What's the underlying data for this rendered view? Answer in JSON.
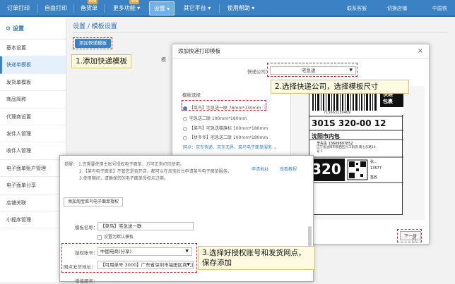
{
  "topnav": {
    "items": [
      "订单打印",
      "自由打印",
      "备货单",
      "更多功能",
      "设置",
      "其它平台",
      "使用帮助"
    ],
    "badge": "new",
    "right": [
      "联系客服",
      "切换店铺",
      "中国铁"
    ]
  },
  "sidebar": {
    "title": "设置",
    "items": [
      "基本设置",
      "快递单模板",
      "发货单模板",
      "商品简称",
      "代理商设置",
      "发件人管理",
      "收件人管理",
      "电子面单账户管理",
      "电子面单分享",
      "店铺关联",
      "小程序管理"
    ]
  },
  "page": {
    "title": "设置 / 模板设置",
    "add_button": "添加快递模板",
    "partial_tab": "模"
  },
  "callouts": {
    "step1": "1.添加快递模板",
    "step2": "2.选择快递公司，选择模板尺寸",
    "step3": "3.选择好授权账号和发货网点，保存添加"
  },
  "dialog1": {
    "title": "添加快递打印模板",
    "close": "×",
    "company_label": "快递公司：",
    "company_value": "宅急送",
    "template_label": "模板选择",
    "options": [
      "【菜鸟】宅急送一联  76mm*130mm",
      "宅急送二联  100mm*180mm",
      "【菜鸟】宅急送猫旗标  100mm*180mm",
      "【拼多多】宅急送二联  100mm*180mm"
    ],
    "links": "网点：京东快递、京东无界、菜鸟电子面单服务",
    "next_button": "下一步"
  },
  "label": {
    "logo_top": "快递",
    "logo_bottom": "包裹",
    "tracking": "715663130409",
    "code": "301S  320-00 12",
    "city": "沈阳市内包",
    "recipient": "李先生    13609897852",
    "address": "辽宁省沈阳市铁西区兴工街道 南七东路10号 1",
    "big_number": "320",
    "phone_partial": "13577",
    "sender": "张...",
    "sign": "签收"
  },
  "dialog2": {
    "notice_prefix": "提醒：",
    "notice_lines": [
      "1.您需要使用主账号授权电子面单，方可正常打印使用。",
      "2.【菜鸟电子面单】不管您是否开店，都可以在淘宝后台申请菜鸟电子面单服务。",
      "3.使用期间，请确保您的电子面单授权未过期。"
    ],
    "apply_link": "申请地址",
    "tutorial_link": "查看教程",
    "auth_button": "添加淘宝菜鸟电子面单授权",
    "name_label": "模板名称：",
    "name_value": "【菜鸟】宅急送一联",
    "default_checkbox": "设置为默认模板",
    "account_label": "授权账号：",
    "account_value": "中国电商(分享)",
    "outlet_label": "网点发货地址：",
    "outlet_value": "【可用单号 3000】广东省深圳市福田区商汇新城",
    "service_label": "增值服务："
  }
}
